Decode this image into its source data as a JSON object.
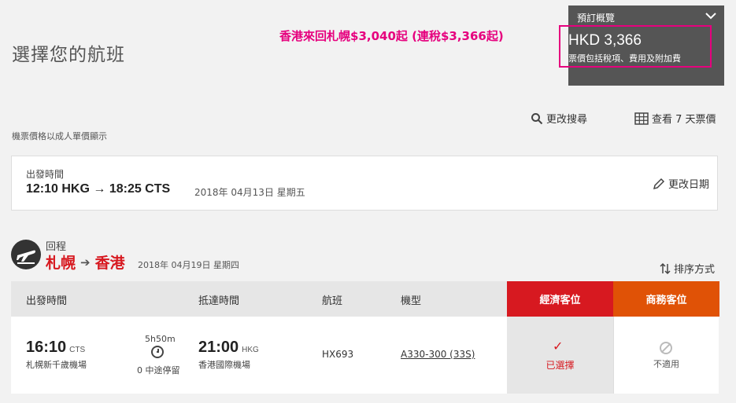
{
  "page_title": "選擇您的航班",
  "promo_text": "香港來回札幌$3,040起 (連稅$3,366起)",
  "summary": {
    "label": "預訂概覽",
    "price": "HKD 3,366",
    "price_note": "票價包括稅項、費用及附加費"
  },
  "actions": {
    "modify_search": "更改搜尋",
    "view_7_days": "查看 7 天票價",
    "change_date": "更改日期",
    "sort": "排序方式"
  },
  "price_note": "機票價格以成人單價顯示",
  "outbound": {
    "label": "出發時間",
    "route": "12:10 HKG → 18:25 CTS",
    "date": "2018年 04月13日 星期五"
  },
  "return": {
    "label": "回程",
    "from": "札幌",
    "to": "香港",
    "date": "2018年 04月19日 星期四"
  },
  "table": {
    "headers": {
      "depart": "出發時間",
      "arrive": "抵達時間",
      "flight": "航班",
      "aircraft": "機型",
      "economy": "經濟客位",
      "business": "商務客位"
    },
    "row": {
      "dep_time": "16:10",
      "dep_code": "CTS",
      "dep_airport": "札幌新千歲機場",
      "duration": "5h50m",
      "stops": "0 中途停留",
      "arr_time": "21:00",
      "arr_code": "HKG",
      "arr_airport": "香港國際機場",
      "flight_no": "HX693",
      "aircraft": "A330-300 (33S)",
      "economy_status": "已選擇",
      "business_status": "不適用"
    }
  },
  "colors": {
    "red": "#d71920",
    "orange": "#e05206",
    "magenta": "#e6007e",
    "summary_bg": "#555555"
  }
}
